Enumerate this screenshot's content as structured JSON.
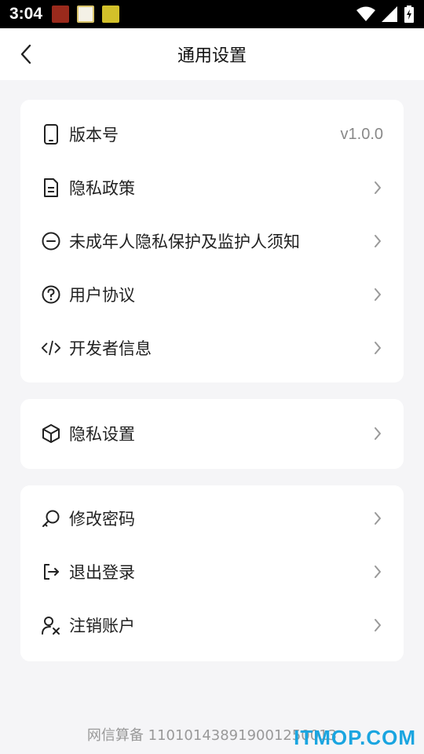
{
  "status_bar": {
    "time": "3:04"
  },
  "header": {
    "title": "通用设置"
  },
  "card1": {
    "items": [
      {
        "label": "版本号",
        "value": "v1.0.0"
      },
      {
        "label": "隐私政策"
      },
      {
        "label": "未成年人隐私保护及监护人须知"
      },
      {
        "label": "用户协议"
      },
      {
        "label": "开发者信息"
      }
    ]
  },
  "card2": {
    "items": [
      {
        "label": "隐私设置"
      }
    ]
  },
  "card3": {
    "items": [
      {
        "label": "修改密码"
      },
      {
        "label": "退出登录"
      },
      {
        "label": "注销账户"
      }
    ]
  },
  "footer": {
    "icp": "网信算备 110101438919001250013"
  },
  "watermark": "ITMOP.COM",
  "colors": {
    "accent": "#1aa5e0",
    "background": "#f5f5f7",
    "card": "#ffffff"
  },
  "icons": {
    "version": "phone-icon",
    "privacy_policy": "document-icon",
    "minor": "minus-circle-icon",
    "agreement": "question-circle-icon",
    "developer": "code-icon",
    "privacy_settings": "cube-icon",
    "password": "key-icon",
    "logout": "logout-icon",
    "delete_account": "user-remove-icon"
  }
}
